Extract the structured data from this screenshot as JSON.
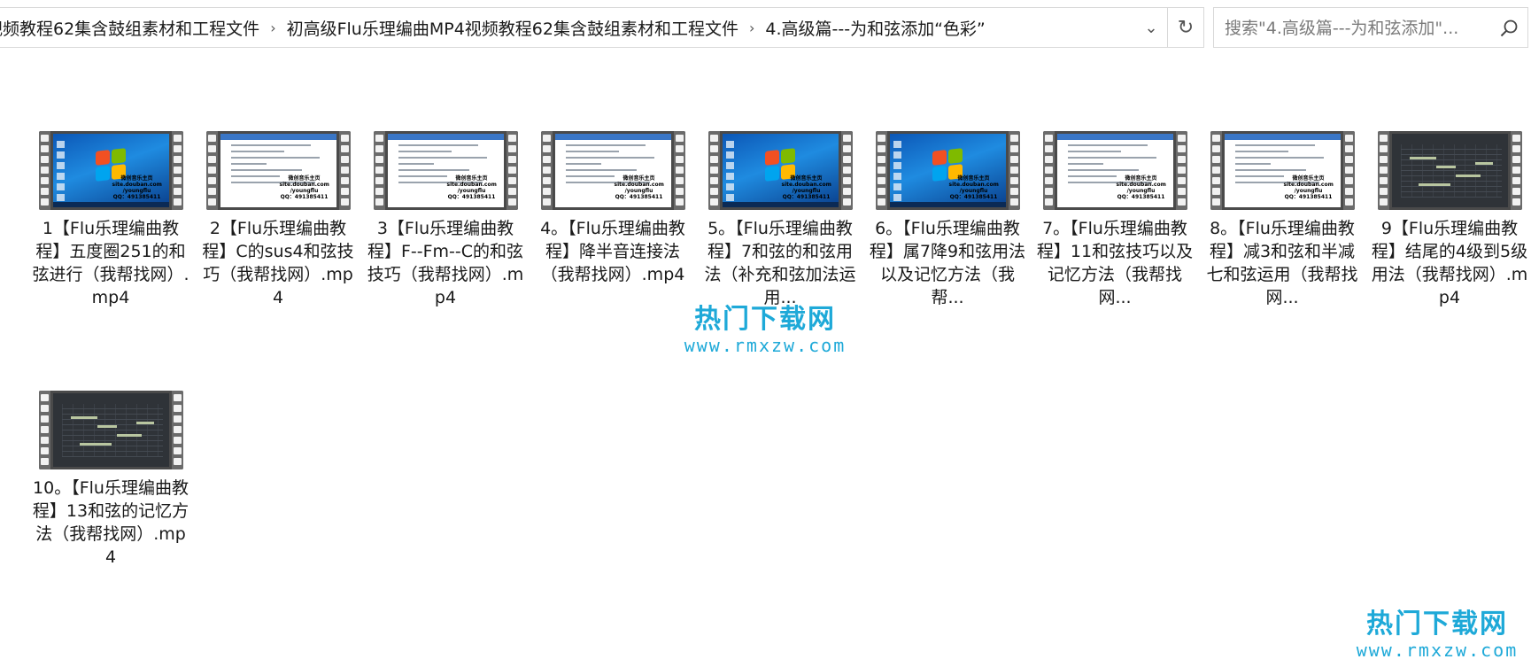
{
  "address_bar": {
    "crumbs": [
      "视频教程62集含鼓组素材和工程文件",
      "初高级Flu乐理编曲MP4视频教程62集含鼓组素材和工程文件",
      "4.高级篇---为和弦添加“色彩”"
    ],
    "separator": "›",
    "dropdown_glyph": "⌄",
    "refresh_glyph": "↻"
  },
  "search": {
    "placeholder": "搜索\"4.高级篇---为和弦添加\"...",
    "icon": "search-icon"
  },
  "files": [
    {
      "name": "1【Flu乐理编曲教程】五度圈251的和弦进行（我帮找网）.mp4",
      "thumb": "desktop"
    },
    {
      "name": "2【Flu乐理编曲教程】C的sus4和弦技巧（我帮找网）.mp4",
      "thumb": "doc"
    },
    {
      "name": "3【Flu乐理编曲教程】F--Fm--C的和弦技巧（我帮找网）.mp4",
      "thumb": "doc"
    },
    {
      "name": "4。【Flu乐理编曲教程】降半音连接法（我帮找网）.mp4",
      "thumb": "doc"
    },
    {
      "name": "5。【Flu乐理编曲教程】7和弦的和弦用法（补充和弦加法运用...",
      "thumb": "desktop"
    },
    {
      "name": "6。【Flu乐理编曲教程】属7降9和弦用法以及记忆方法（我帮...",
      "thumb": "desktop"
    },
    {
      "name": "7。【Flu乐理编曲教程】11和弦技巧以及记忆方法（我帮找网...",
      "thumb": "doc"
    },
    {
      "name": "8。【Flu乐理编曲教程】减3和弦和半减七和弦运用（我帮找网...",
      "thumb": "doc"
    },
    {
      "name": "9【Flu乐理编曲教程】结尾的4级到5级用法（我帮找网）.mp4",
      "thumb": "daw"
    },
    {
      "name": "10。【Flu乐理编曲教程】13和弦的记忆方法（我帮找网）.mp4",
      "thumb": "daw"
    }
  ],
  "thumb_watermark": [
    "微创音乐主页",
    "site.douban.com",
    "/youngflu",
    "QQ：491385411"
  ],
  "watermarks": [
    {
      "cn": "热门下载网",
      "url": "www.rmxzw.com"
    },
    {
      "cn": "热门下载网",
      "url": "www.rmxzw.com"
    }
  ],
  "colors": {
    "watermark": "#1ea9d8",
    "border": "#d9d9d9",
    "text": "#1a1a1a"
  }
}
